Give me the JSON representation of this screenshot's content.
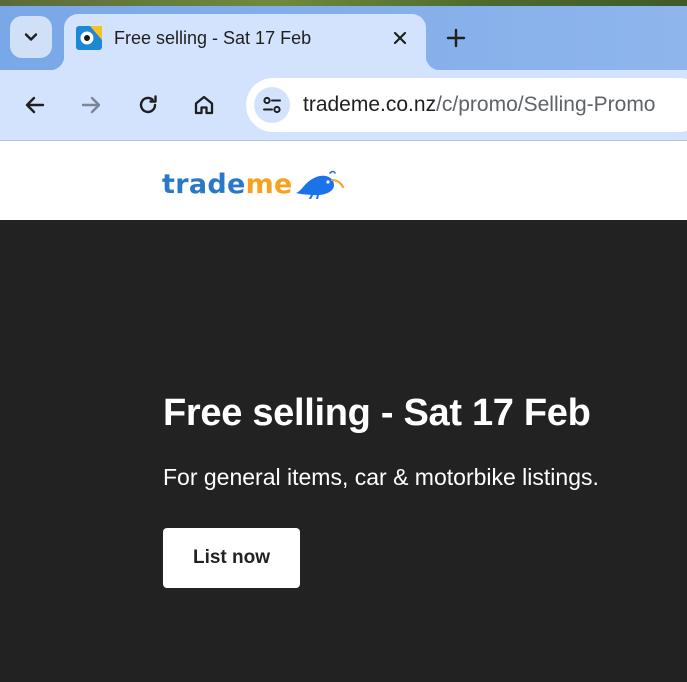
{
  "browser": {
    "tab": {
      "title": "Free selling - Sat 17 Feb"
    },
    "address_bar": {
      "host": "trademe.co.nz",
      "path": "/c/promo/Selling-Promo"
    },
    "icons": {
      "tab_search": "chevron-down-icon",
      "favicon": "trademe-kiwi-favicon",
      "close": "close-icon",
      "new_tab": "plus-icon",
      "back": "arrow-left-icon",
      "forward": "arrow-right-icon",
      "reload": "reload-icon",
      "home": "home-icon",
      "site_info": "tune-icon"
    },
    "colors": {
      "tabstrip": "#8fb5ec",
      "toolbar": "#d3e3fd"
    }
  },
  "site": {
    "logo": {
      "part1": "trade",
      "part2": "me"
    },
    "colors": {
      "trade_blue": "#2979c8",
      "me_orange": "#f6a21d",
      "kiwi_blue": "#1a73e8"
    }
  },
  "hero": {
    "title": "Free selling - Sat 17 Feb",
    "subtitle": "For general items, car & motorbike listings.",
    "cta_label": "List now",
    "colors": {
      "background": "#222222",
      "text": "#ffffff"
    }
  }
}
